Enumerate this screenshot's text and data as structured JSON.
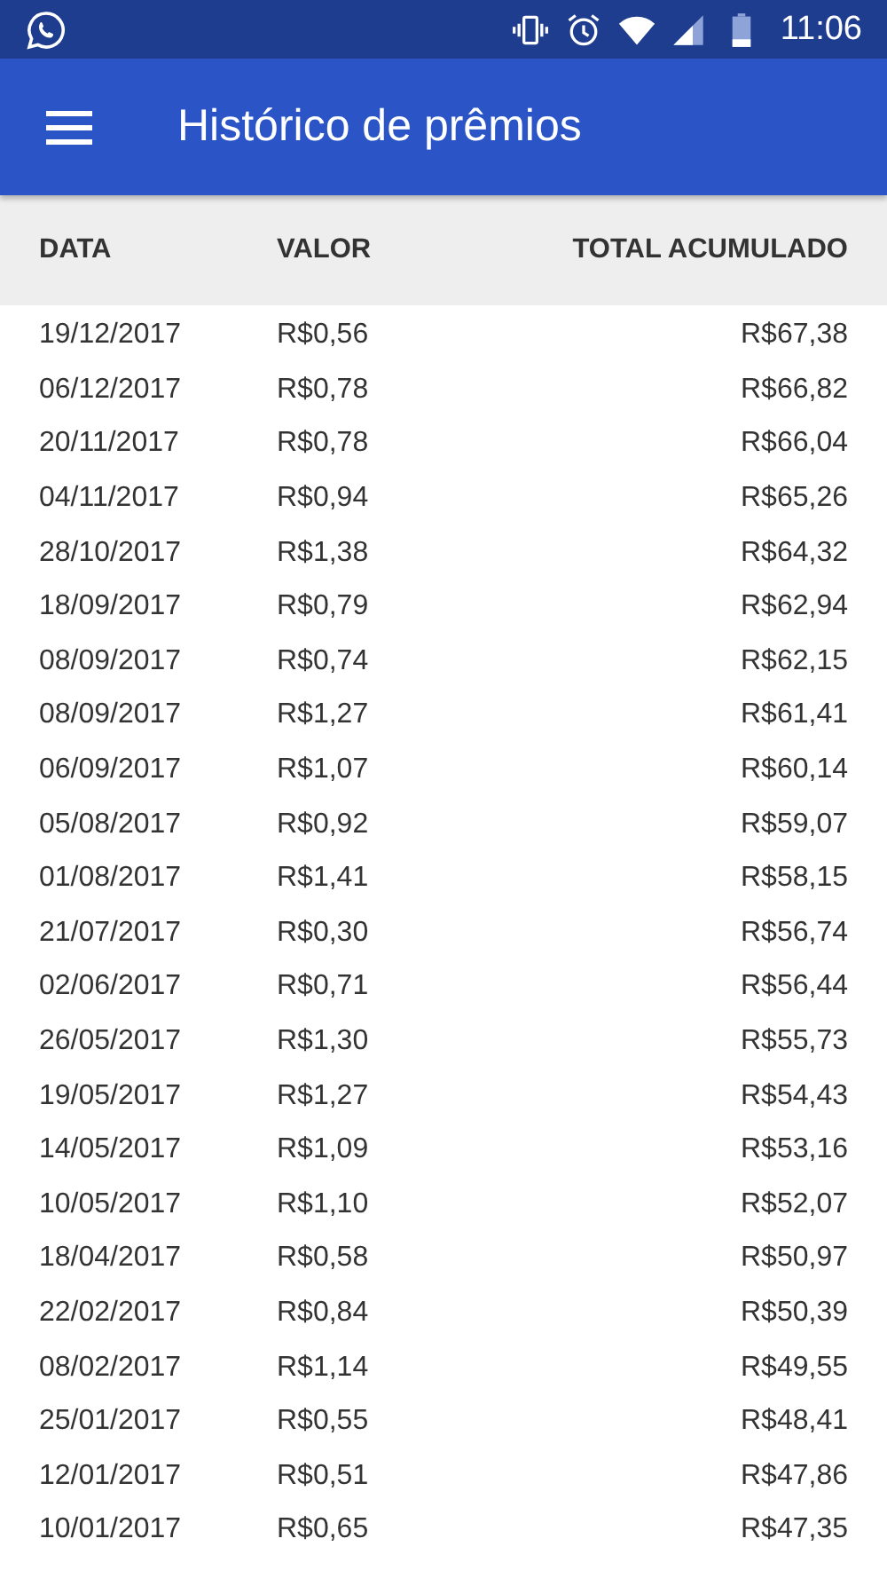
{
  "status_bar": {
    "time": "11:06"
  },
  "app_bar": {
    "title": "Histórico de prêmios"
  },
  "table": {
    "columns": [
      "DATA",
      "VALOR",
      "TOTAL ACUMULADO"
    ],
    "rows": [
      [
        "19/12/2017",
        "R$0,56",
        "R$67,38"
      ],
      [
        "06/12/2017",
        "R$0,78",
        "R$66,82"
      ],
      [
        "20/11/2017",
        "R$0,78",
        "R$66,04"
      ],
      [
        "04/11/2017",
        "R$0,94",
        "R$65,26"
      ],
      [
        "28/10/2017",
        "R$1,38",
        "R$64,32"
      ],
      [
        "18/09/2017",
        "R$0,79",
        "R$62,94"
      ],
      [
        "08/09/2017",
        "R$0,74",
        "R$62,15"
      ],
      [
        "08/09/2017",
        "R$1,27",
        "R$61,41"
      ],
      [
        "06/09/2017",
        "R$1,07",
        "R$60,14"
      ],
      [
        "05/08/2017",
        "R$0,92",
        "R$59,07"
      ],
      [
        "01/08/2017",
        "R$1,41",
        "R$58,15"
      ],
      [
        "21/07/2017",
        "R$0,30",
        "R$56,74"
      ],
      [
        "02/06/2017",
        "R$0,71",
        "R$56,44"
      ],
      [
        "26/05/2017",
        "R$1,30",
        "R$55,73"
      ],
      [
        "19/05/2017",
        "R$1,27",
        "R$54,43"
      ],
      [
        "14/05/2017",
        "R$1,09",
        "R$53,16"
      ],
      [
        "10/05/2017",
        "R$1,10",
        "R$52,07"
      ],
      [
        "18/04/2017",
        "R$0,58",
        "R$50,97"
      ],
      [
        "22/02/2017",
        "R$0,84",
        "R$50,39"
      ],
      [
        "08/02/2017",
        "R$1,14",
        "R$49,55"
      ],
      [
        "25/01/2017",
        "R$0,55",
        "R$48,41"
      ],
      [
        "12/01/2017",
        "R$0,51",
        "R$47,86"
      ],
      [
        "10/01/2017",
        "R$0,65",
        "R$47,35"
      ]
    ]
  }
}
